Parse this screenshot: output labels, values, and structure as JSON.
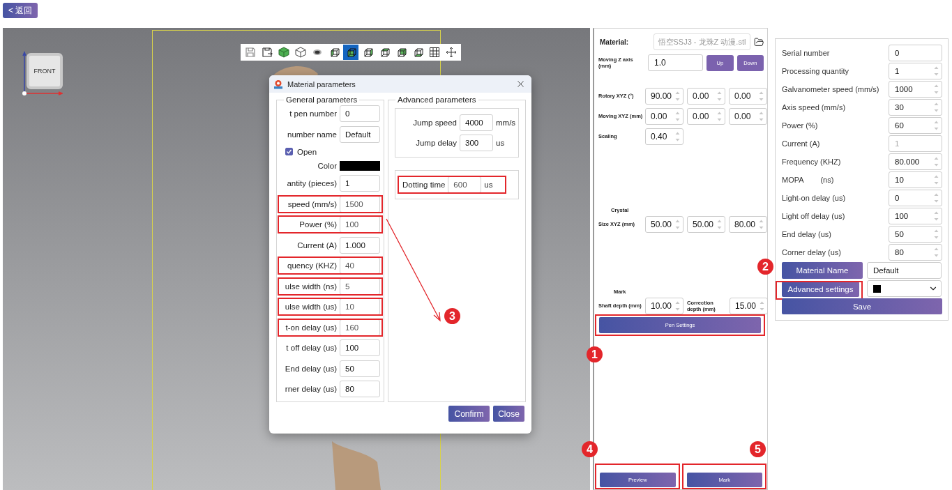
{
  "back_button": "< 返回",
  "viewport": {
    "view_cube_label": "FRONT",
    "toolbar": [
      {
        "selected": false
      },
      {
        "selected": false
      },
      {
        "selected": false
      },
      {
        "selected": false
      },
      {
        "selected": false
      },
      {
        "selected": false
      },
      {
        "selected": true
      },
      {
        "selected": false
      },
      {
        "selected": false
      },
      {
        "selected": false
      },
      {
        "selected": false
      },
      {
        "selected": false
      },
      {
        "selected": false
      }
    ]
  },
  "dialog": {
    "title": "Material parameters",
    "general": {
      "title": "General parameters",
      "rows": [
        {
          "kind": "field",
          "label": "t pen number",
          "value": "0",
          "highlighted": false
        },
        {
          "kind": "field",
          "label": "number name",
          "value": "Default",
          "highlighted": false
        },
        {
          "kind": "checkbox",
          "label": "Open",
          "checked": true
        },
        {
          "kind": "color",
          "label": "Color",
          "color": "#000000"
        },
        {
          "kind": "field",
          "label": "antity (pieces)",
          "value": "1",
          "highlighted": false
        },
        {
          "kind": "field",
          "label": "speed (mm/s)",
          "value": "1500",
          "highlighted": true
        },
        {
          "kind": "field",
          "label": "Power (%)",
          "value": "100",
          "highlighted": true
        },
        {
          "kind": "field",
          "label": "Current (A)",
          "value": "1.000",
          "highlighted": false
        },
        {
          "kind": "field",
          "label": "quency (KHZ)",
          "value": "40",
          "highlighted": true
        },
        {
          "kind": "field",
          "label": "ulse width (ns)",
          "value": "5",
          "highlighted": true
        },
        {
          "kind": "field",
          "label": "ulse width (us)",
          "value": "10",
          "highlighted": true
        },
        {
          "kind": "field",
          "label": "t-on delay (us)",
          "value": "160",
          "highlighted": true
        },
        {
          "kind": "field",
          "label": "t off delay (us)",
          "value": "100",
          "highlighted": false
        },
        {
          "kind": "field",
          "label": "End delay (us)",
          "value": "50",
          "highlighted": false
        },
        {
          "kind": "field",
          "label": "rner delay (us)",
          "value": "80",
          "highlighted": false
        }
      ]
    },
    "advanced": {
      "title": "Advanced parameters",
      "boxes": [
        {
          "rows": [
            {
              "label": "Jump speed",
              "value": "4000",
              "unit": "mm/s",
              "highlighted": false
            },
            {
              "label": "Jump delay",
              "value": "300",
              "unit": "us",
              "highlighted": false
            }
          ]
        },
        {
          "rows": [
            {
              "label": "Dotting time",
              "value": "600",
              "unit": "us",
              "highlighted": true
            }
          ]
        }
      ]
    },
    "buttons": [
      "Confirm",
      "Close"
    ]
  },
  "model_panel": {
    "material_label": "Material:",
    "material_file": "悟空SSJ3 - 龙珠Z 动漫.stl",
    "z_axis": {
      "label": "Moving Z axis (mm)",
      "value": "1.0",
      "buttons": [
        "Up",
        "Down"
      ]
    },
    "rotary": {
      "label": "Rotary XYZ (°)",
      "values": [
        "90.00",
        "0.00",
        "0.00"
      ]
    },
    "moving": {
      "label": "Moving XYZ (mm)",
      "values": [
        "0.00",
        "0.00",
        "0.00"
      ]
    },
    "scaling": {
      "label": "Scaling",
      "value": "0.40"
    },
    "crystal": {
      "heading": "Crystal",
      "label": "Size XYZ (mm)",
      "values": [
        "50.00",
        "50.00",
        "80.00"
      ]
    },
    "mark": {
      "heading": "Mark",
      "shaft_label": "Shaft depth (mm)",
      "shaft_value": "10.00",
      "correction_label": "Correction depth (mm)",
      "correction_value": "15.00"
    },
    "pen_settings": {
      "label": "Pen Settings",
      "highlighted": true
    },
    "actions": [
      {
        "label": "Preview",
        "highlighted": true
      },
      {
        "label": "Mark",
        "highlighted": true
      }
    ]
  },
  "pen_panel": {
    "rows": [
      {
        "label": "Serial number",
        "value": "0",
        "stepper": false,
        "disabled": false
      },
      {
        "label": "Processing quantity",
        "value": "1",
        "stepper": true,
        "disabled": false
      },
      {
        "label": "Galvanometer speed (mm/s)",
        "value": "1000",
        "stepper": true,
        "disabled": false
      },
      {
        "label": "Axis speed (mm/s)",
        "value": "30",
        "stepper": true,
        "disabled": false
      },
      {
        "label": "Power (%)",
        "value": "60",
        "stepper": true,
        "disabled": false
      },
      {
        "label": "Current (A)",
        "value": "1",
        "stepper": false,
        "disabled": true
      },
      {
        "label": "Frequency (KHZ)",
        "value": "80.000",
        "stepper": true,
        "disabled": false
      },
      {
        "label": "MOPA        (ns)",
        "value": "10",
        "stepper": true,
        "disabled": false
      },
      {
        "label": "Light-on delay (us)",
        "value": "0",
        "stepper": true,
        "disabled": false
      },
      {
        "label": "Light off delay (us)",
        "value": "100",
        "stepper": true,
        "disabled": false
      },
      {
        "label": "End delay (us)",
        "value": "50",
        "stepper": true,
        "disabled": false
      },
      {
        "label": "Corner delay (us)",
        "value": "80",
        "stepper": true,
        "disabled": false
      }
    ],
    "material_name": {
      "button": "Material Name",
      "value": "Default"
    },
    "advanced": {
      "button": "Advanced settings",
      "highlighted": true,
      "color": "#000000"
    },
    "save": "Save"
  },
  "annotations": [
    {
      "number": "1"
    },
    {
      "number": "2"
    },
    {
      "number": "3"
    },
    {
      "number": "4"
    },
    {
      "number": "5"
    }
  ]
}
